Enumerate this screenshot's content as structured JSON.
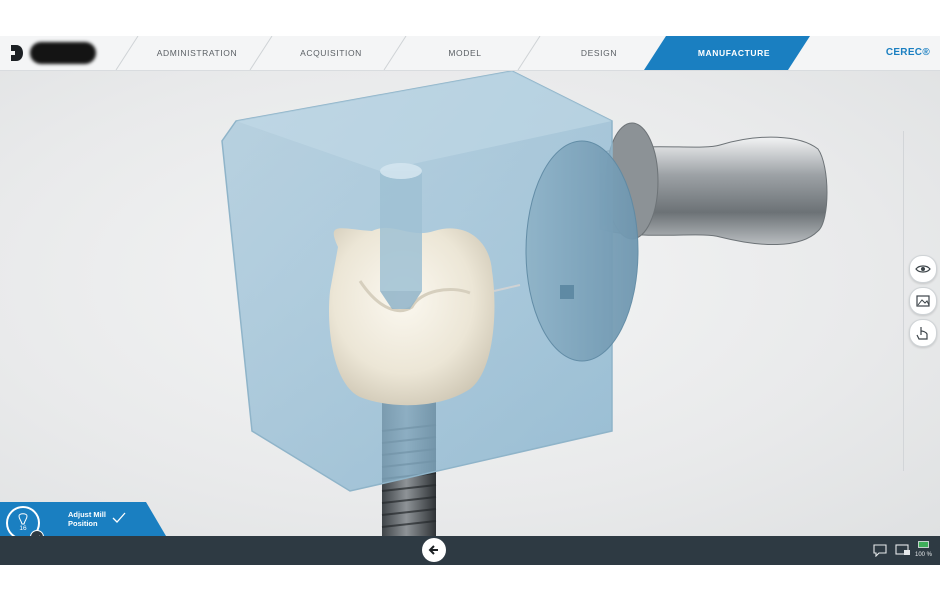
{
  "header": {
    "tabs": [
      {
        "label": "ADMINISTRATION",
        "active": false
      },
      {
        "label": "ACQUISITION",
        "active": false
      },
      {
        "label": "MODEL",
        "active": false
      },
      {
        "label": "DESIGN",
        "active": false
      },
      {
        "label": "MANUFACTURE",
        "active": true
      }
    ],
    "brand": "CEREC®"
  },
  "viewport": {
    "scene": [
      "milling-block",
      "crown",
      "drill-tool",
      "block-holder",
      "implant-screw"
    ]
  },
  "side_toolbar": {
    "buttons": [
      {
        "icon": "eye-icon"
      },
      {
        "icon": "image-icon"
      },
      {
        "icon": "hand-pointer-icon"
      }
    ]
  },
  "step": {
    "tooth_number": "16",
    "label": "Adjust Mill Position",
    "status": "completed"
  },
  "statusbar": {
    "battery_text": "100 %"
  },
  "colors": {
    "accent": "#1a7fc1",
    "bottom_bar": "#2e3a43",
    "topbar": "#f4f5f6"
  }
}
